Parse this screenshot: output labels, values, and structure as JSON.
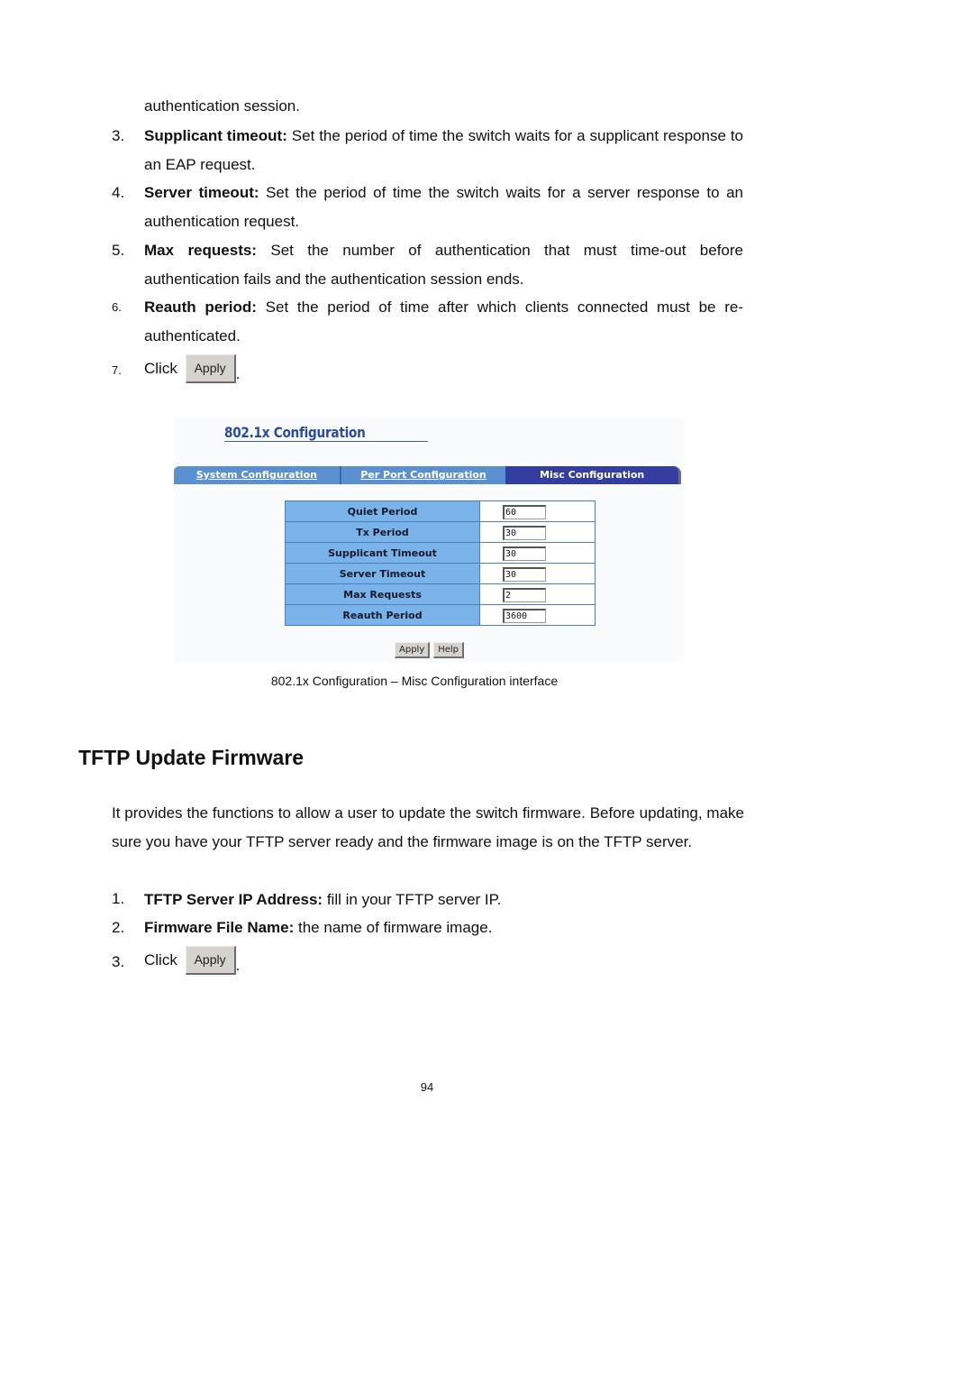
{
  "upper_list": {
    "continuation": "authentication session.",
    "items": [
      {
        "num": "3.",
        "term": "Supplicant timeout:",
        "text": " Set the period of time the switch waits for a supplicant response to an EAP request."
      },
      {
        "num": "4.",
        "term": "Server timeout:",
        "text": " Set the period of time the switch waits for a server response to an authentication request."
      },
      {
        "num": "5.",
        "term": "Max requests:",
        "text": " Set the number of authentication that must time-out before authentication fails and the authentication session ends."
      },
      {
        "num": "6.",
        "term": "Reauth period:",
        "text": " Set the period of time after which clients connected must be re-authenticated."
      }
    ],
    "click_step": {
      "num": "7.",
      "prefix": "Click",
      "button": "Apply",
      "suffix": "."
    }
  },
  "screenshot": {
    "title": "802.1x Configuration",
    "tabs": [
      {
        "label": "System Configuration",
        "active": false
      },
      {
        "label": "Per Port Configuration",
        "active": false
      },
      {
        "label": "Misc Configuration",
        "active": true
      }
    ],
    "rows": [
      {
        "label": "Quiet Period",
        "value": "60"
      },
      {
        "label": "Tx Period",
        "value": "30"
      },
      {
        "label": "Supplicant Timeout",
        "value": "30"
      },
      {
        "label": "Server Timeout",
        "value": "30"
      },
      {
        "label": "Max Requests",
        "value": "2"
      },
      {
        "label": "Reauth Period",
        "value": "3600"
      }
    ],
    "buttons": {
      "apply": "Apply",
      "help": "Help"
    },
    "colors": {
      "tab_inactive": "#5a8fd0",
      "tab_active": "#333ea0",
      "label_cell": "#7ab2ea",
      "title": "#2a4aa0"
    }
  },
  "caption": "802.1x Configuration – Misc Configuration interface",
  "section": {
    "heading": "TFTP Update Firmware",
    "intro": "It provides the functions to allow a user to update the switch firmware. Before updating, make sure you have your TFTP server ready and the firmware image is on the TFTP server.",
    "items": [
      {
        "num": "1.",
        "term": "TFTP Server IP Address:",
        "text": " fill in your TFTP server IP."
      },
      {
        "num": "2.",
        "term": "Firmware File Name:",
        "text": " the name of firmware image."
      }
    ],
    "click_step": {
      "num": "3.",
      "prefix": "Click",
      "button": "Apply",
      "suffix": "."
    }
  },
  "page_number": "94"
}
